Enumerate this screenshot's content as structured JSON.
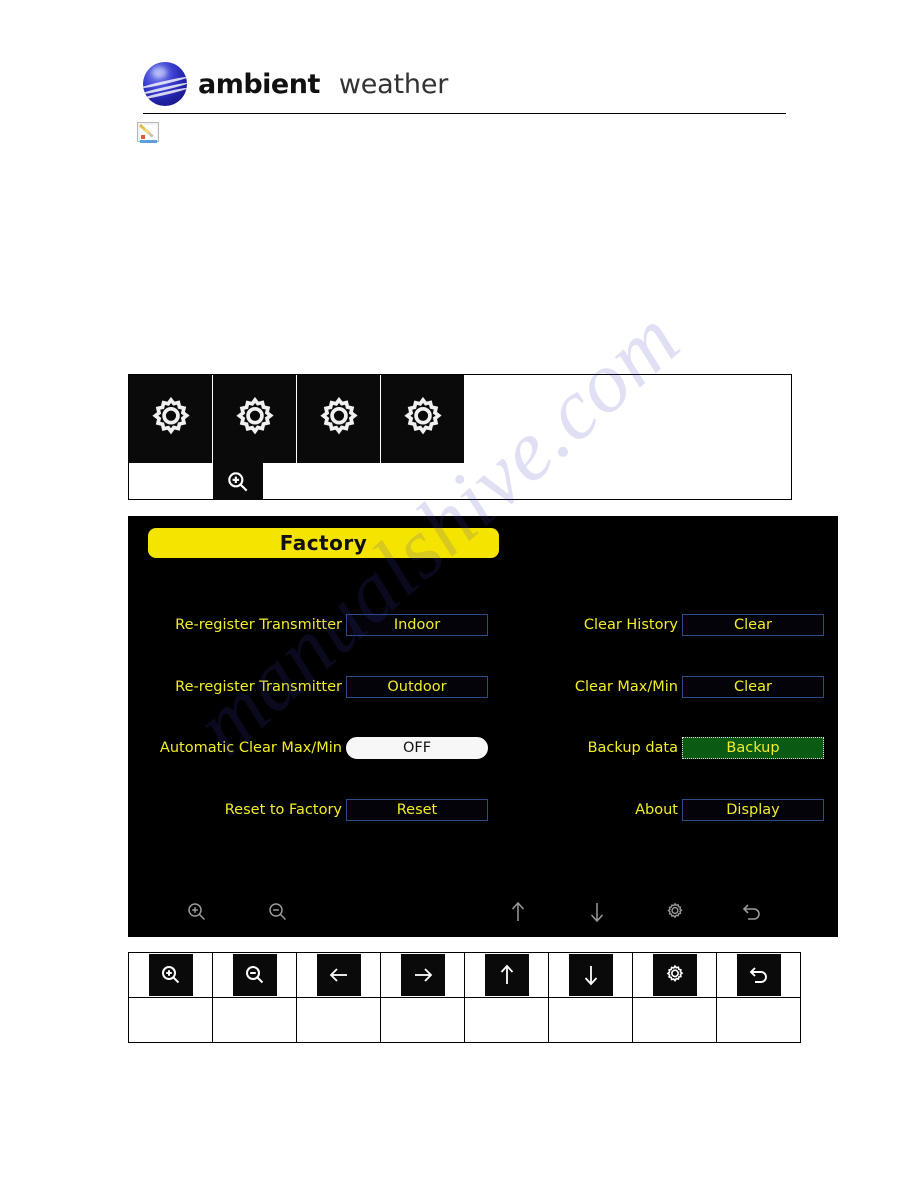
{
  "brand": {
    "name_bold": "ambient",
    "name_light": "weather",
    "logo_icon": "ambient-weather-sphere-logo"
  },
  "watermark": {
    "text": "manualshive.com"
  },
  "note_icon": {
    "name": "note-edit-placeholder-icon"
  },
  "gear_strip": {
    "icons": [
      {
        "name": "gear-icon",
        "glyph": "gear"
      },
      {
        "name": "gear-icon",
        "glyph": "gear"
      },
      {
        "name": "gear-icon",
        "glyph": "gear"
      },
      {
        "name": "gear-icon",
        "glyph": "gear"
      }
    ],
    "magnifier": {
      "name": "zoom-in-icon",
      "glyph": "magnifier-plus"
    }
  },
  "device_screen": {
    "title": "Factory",
    "left_column": [
      {
        "label": "Re-register Transmitter",
        "button": "Indoor",
        "state": "normal"
      },
      {
        "label": "Re-register Transmitter",
        "button": "Outdoor",
        "state": "normal"
      },
      {
        "label": "Automatic Clear Max/Min",
        "button": "OFF",
        "state": "selected"
      },
      {
        "label": "Reset to Factory",
        "button": "Reset",
        "state": "normal"
      }
    ],
    "right_column": [
      {
        "label": "Clear History",
        "button": "Clear",
        "state": "normal"
      },
      {
        "label": "Clear Max/Min",
        "button": "Clear",
        "state": "normal"
      },
      {
        "label": "Backup data",
        "button": "Backup",
        "state": "focused"
      },
      {
        "label": "About",
        "button": "Display",
        "state": "normal"
      }
    ],
    "toolbar": [
      {
        "name": "zoom-in-icon",
        "glyph": "magnifier-plus"
      },
      {
        "name": "zoom-out-icon",
        "glyph": "magnifier-minus"
      },
      {
        "name": "arrow-up-icon",
        "glyph": "arrow-up"
      },
      {
        "name": "arrow-down-icon",
        "glyph": "arrow-down"
      },
      {
        "name": "gear-icon",
        "glyph": "gear"
      },
      {
        "name": "back-icon",
        "glyph": "back-arrow"
      }
    ],
    "colors": {
      "title_bar": "#f5e400",
      "label_text": "#f2ed2a",
      "button_border": "#2b4a86",
      "selected_button_bg": "#f7f7f7",
      "focused_button_bg": "#0b5a14",
      "screen_bg": "#000000"
    }
  },
  "legend_table": {
    "icons": [
      {
        "name": "zoom-in-icon",
        "glyph": "magnifier-plus"
      },
      {
        "name": "zoom-out-icon",
        "glyph": "magnifier-minus"
      },
      {
        "name": "arrow-left-icon",
        "glyph": "arrow-left"
      },
      {
        "name": "arrow-right-icon",
        "glyph": "arrow-right"
      },
      {
        "name": "arrow-up-icon",
        "glyph": "arrow-up"
      },
      {
        "name": "arrow-down-icon",
        "glyph": "arrow-down"
      },
      {
        "name": "gear-icon",
        "glyph": "gear"
      },
      {
        "name": "back-icon",
        "glyph": "back-arrow"
      }
    ],
    "captions": [
      "",
      "",
      "",
      "",
      "",
      "",
      "",
      ""
    ]
  }
}
